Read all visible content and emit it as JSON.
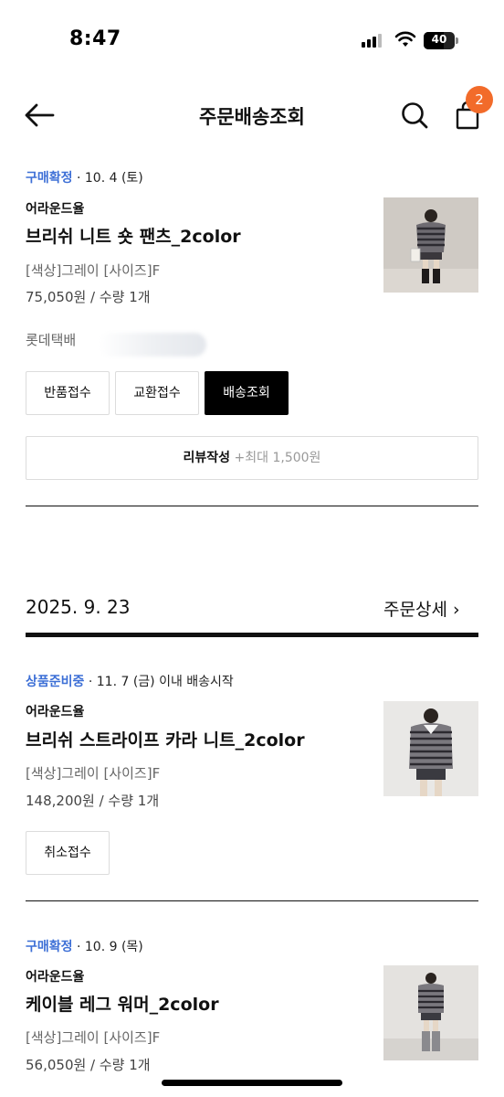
{
  "status_bar": {
    "time": "8:47",
    "battery": "40",
    "icons": [
      "signal-icon",
      "wifi-icon",
      "battery-icon"
    ]
  },
  "header": {
    "title": "주문배송조회",
    "cart_count": "2",
    "icons": [
      "arrow-left-icon",
      "search-icon",
      "shopping-bag-icon"
    ]
  },
  "order1": {
    "status": "구매확정",
    "status_date": " · 10. 4 (토)",
    "brand": "어라운드율",
    "product_name": "브리쉬 니트 숏 팬츠_2color",
    "option": "[색상]그레이 [사이즈]F",
    "price": "75,050원 / 수량 1개",
    "courier": "롯데택배",
    "buttons": {
      "return": "반품접수",
      "exchange": "교환접수",
      "tracking": "배송조회"
    },
    "review": {
      "label": "리뷰작성",
      "max": " +최대 1,500원"
    }
  },
  "order_group": {
    "date": "2025. 9. 23",
    "detail_link": "주문상세 ›"
  },
  "order2": {
    "status": "상품준비중",
    "status_date": " · 11. 7 (금) 이내 배송시작",
    "brand": "어라운드율",
    "product_name": "브리쉬 스트라이프 카라 니트_2color",
    "option": "[색상]그레이 [사이즈]F",
    "price": "148,200원 / 수량 1개",
    "buttons": {
      "cancel": "취소접수"
    }
  },
  "order3": {
    "status": "구매확정",
    "status_date": " · 10. 9 (목)",
    "brand": "어라운드율",
    "product_name": "케이블 레그 워머_2color",
    "option": "[색상]그레이 [사이즈]F",
    "price": "56,050원 / 수량 1개"
  },
  "colors": {
    "status_blue": "#3d6fd6",
    "badge_orange": "#f26b2a",
    "primary_button": "#000000"
  }
}
